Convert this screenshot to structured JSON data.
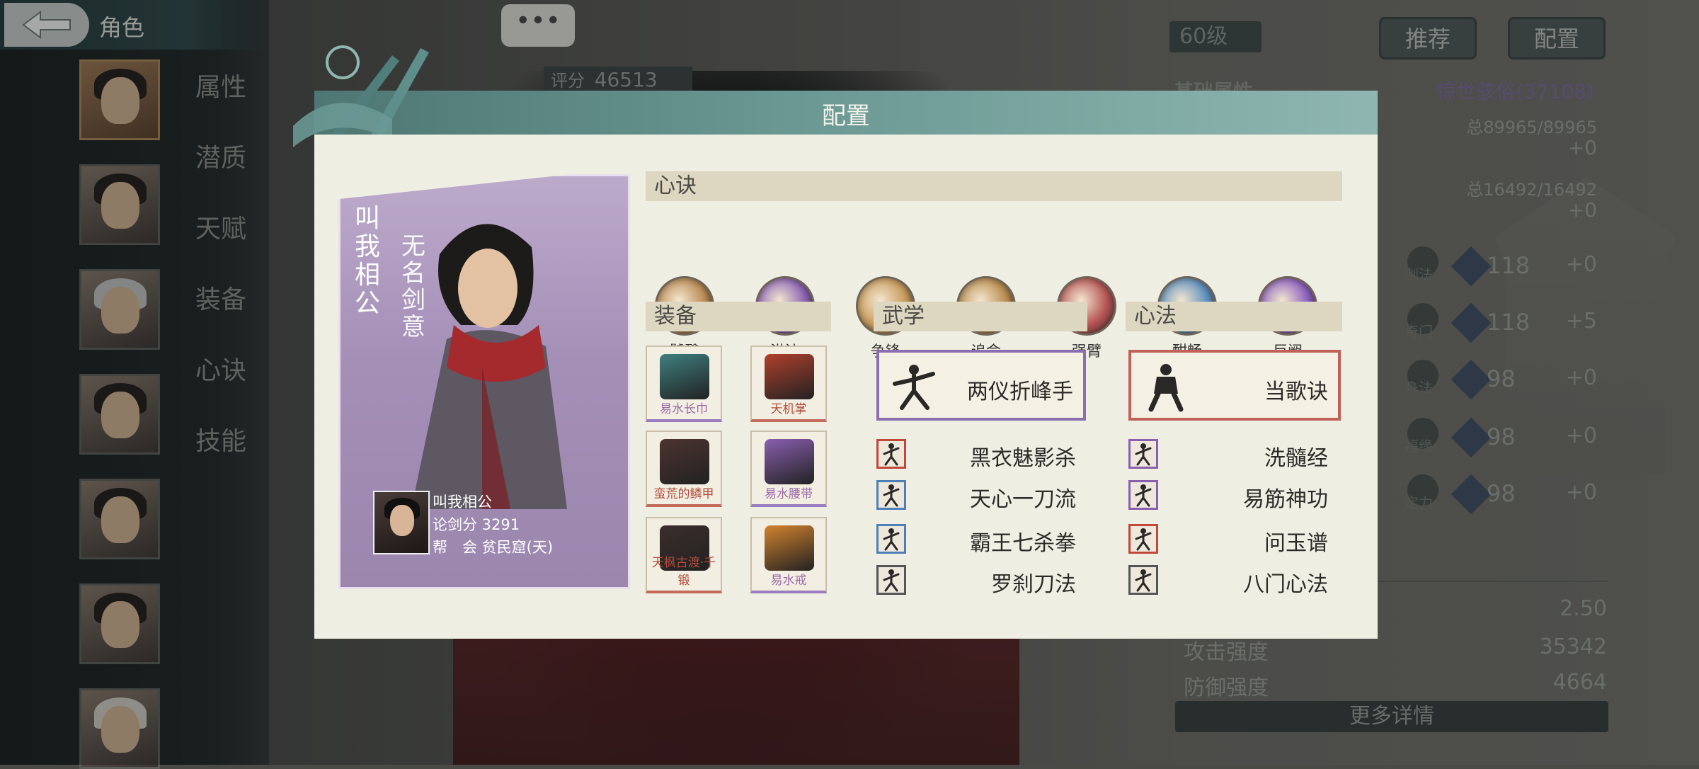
{
  "topbar": {
    "title": "角色"
  },
  "sidebar": {
    "menu": [
      "属性",
      "潜质",
      "天赋",
      "装备",
      "心诀",
      "技能"
    ]
  },
  "right": {
    "level": "60级",
    "recommend_label": "推荐",
    "config_label": "配置",
    "score_label": "评分",
    "score_value": "46513",
    "basic_attr_label": "基础属性",
    "rank_text": "惊世骇俗(37108)",
    "hp_total": "总89965/89965",
    "hp_plus": "+0",
    "mp_total": "总16492/16492",
    "mp_plus": "+0",
    "stats": [
      {
        "label": "剑法",
        "value": "118",
        "plus": "+0"
      },
      {
        "label": "奇门",
        "value": "118",
        "plus": "+5"
      },
      {
        "label": "身法",
        "value": "98",
        "plus": "+0"
      },
      {
        "label": "福缘",
        "value": "98",
        "plus": "+0"
      },
      {
        "label": "定力",
        "value": "98",
        "plus": "+0"
      }
    ],
    "crit_value": "2.50",
    "attack_label": "攻击强度",
    "attack_value": "35342",
    "defense_label": "防御强度",
    "defense_value": "4664",
    "more_label": "更多详情"
  },
  "dialog": {
    "title": "配置",
    "character": {
      "name": "叫我相公",
      "title": "无名剑意",
      "info_name": "叫我相公",
      "info_score": "论剑分 3291",
      "info_guild": "帮　会 贫民窟(天)"
    },
    "mind_header": "心诀",
    "mind_skills": [
      {
        "label": "饕餮",
        "color": "#b98a52"
      },
      {
        "label": "洪流",
        "color": "#8a63b5"
      },
      {
        "label": "争锋",
        "color": "#c79a5a"
      },
      {
        "label": "追命",
        "color": "#b88c4e"
      },
      {
        "label": "强臂",
        "color": "#b55454"
      },
      {
        "label": "酣畅",
        "color": "#5b8fbd"
      },
      {
        "label": "巨阙",
        "color": "#8b5fc0"
      }
    ],
    "equip_header": "装备",
    "equipment": [
      {
        "name": "易水长巾",
        "rarity": "purple",
        "color": "#3f7f7f"
      },
      {
        "name": "天机掌",
        "rarity": "red",
        "color": "#b0402c"
      },
      {
        "name": "蛮荒的鳞甲",
        "rarity": "red",
        "color": "#4c3430"
      },
      {
        "name": "易水腰带",
        "rarity": "purple",
        "color": "#8a5fb0"
      },
      {
        "name": "天枫古渡·千锻",
        "rarity": "red",
        "color": "#3b2e2a"
      },
      {
        "name": "易水戒",
        "rarity": "purple",
        "color": "#d2822e"
      }
    ],
    "martial_header": "武学",
    "martial_main": "两仪折峰手",
    "martial_skills": [
      {
        "name": "黑衣魅影杀",
        "border": "#c0483a"
      },
      {
        "name": "天心一刀流",
        "border": "#4f7fb8"
      },
      {
        "name": "霸王七杀拳",
        "border": "#4f7fb8"
      },
      {
        "name": "罗刹刀法",
        "border": "#555555"
      }
    ],
    "heart_header": "心法",
    "heart_main": "当歌诀",
    "heart_skills": [
      {
        "name": "洗髓经",
        "border": "#8a5fb0"
      },
      {
        "name": "易筋神功",
        "border": "#8a5fb0"
      },
      {
        "name": "问玉谱",
        "border": "#c0483a"
      },
      {
        "name": "八门心法",
        "border": "#555555"
      }
    ]
  },
  "colors": {
    "dialog_header": "#6a9893",
    "dialog_body": "#efeee3",
    "purple_rarity": "#9a7cc0",
    "red_rarity": "#c36a5c"
  }
}
